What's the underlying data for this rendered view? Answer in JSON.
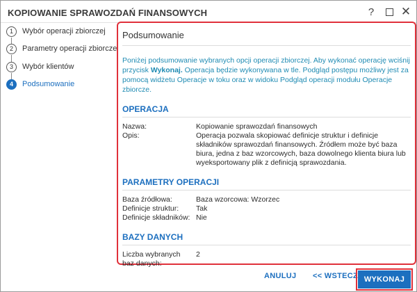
{
  "window": {
    "title": "KOPIOWANIE SPRAWOZDAŃ FINANSOWYCH",
    "help": "?",
    "close": "✕"
  },
  "steps": [
    {
      "num": "1",
      "label": "Wybór operacji zbiorczej"
    },
    {
      "num": "2",
      "label": "Parametry operacji zbiorczej"
    },
    {
      "num": "3",
      "label": "Wybór klientów"
    },
    {
      "num": "4",
      "label": "Podsumowanie",
      "active": true
    }
  ],
  "summary": {
    "title": "Podsumowanie",
    "intro_1": "Poniżej podsumowanie wybranych opcji operacji zbiorczej. Aby wykonać operację wciśnij przycisk ",
    "intro_bold": "Wykonaj.",
    "intro_2": " Operacja będzie wykonywana w tle. Podgląd postępu możliwy jest za pomocą widżetu Operacje w toku oraz w widoku Podgląd operacji modułu Operacje zbiorcze.",
    "operacja": {
      "heading": "OPERACJA",
      "name_key": "Nazwa:",
      "name_val": "Kopiowanie sprawozdań finansowych",
      "desc_key": "Opis:",
      "desc_val": "Operacja pozwala skopiować definicje struktur i definicje składników sprawozdań finansowych. Źródłem może być baza biura, jedna z baz wzorcowych, baza dowolnego klienta biura lub wyeksportowany plik z definicją sprawozdania."
    },
    "parametry": {
      "heading": "PARAMETRY OPERACJI",
      "rows": [
        {
          "k": "Baza źródłowa:",
          "v": "Baza wzorcowa: Wzorzec"
        },
        {
          "k": "Definicje struktur:",
          "v": "Tak"
        },
        {
          "k": "Definicje składników:",
          "v": "Nie"
        }
      ]
    },
    "bazy": {
      "heading": "BAZY DANYCH",
      "count_key": "Liczba wybranych baz danych:",
      "count_val": "2"
    }
  },
  "footer": {
    "cancel": "ANULUJ",
    "back": "<< WSTECZ",
    "execute": "WYKONAJ"
  }
}
